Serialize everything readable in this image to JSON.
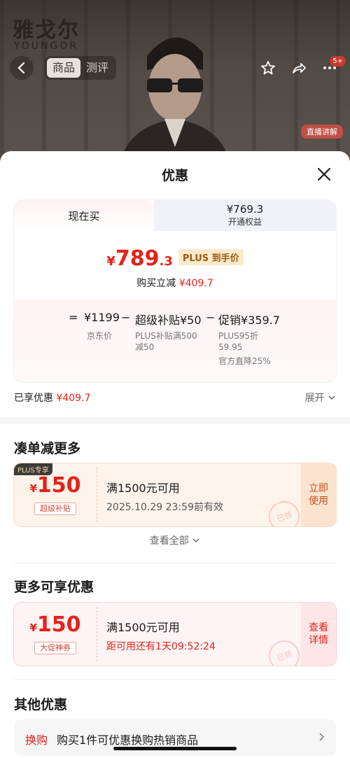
{
  "background": {
    "brand_logo": "雅戈尔",
    "brand_sub": "YOUNGOR",
    "nav_tabs": [
      "商品",
      "测评"
    ],
    "active_tab": 0,
    "more_badge": "5+",
    "live_tag": "直播讲解"
  },
  "sheet": {
    "title": "优惠",
    "price_card": {
      "tab_now": "现在买",
      "tab_plus_price": "¥769.3",
      "tab_plus_label": "开通权益",
      "yen": "¥",
      "price_int": "789",
      "price_dec": ".3",
      "plus_tag": "PLUS 到手价",
      "reduce_label": "购买立减",
      "reduce_value": "¥409.7",
      "formula": {
        "eq": "=",
        "jd_price": "¥1199",
        "minus1": "−",
        "subsidy": "超级补贴¥50",
        "minus2": "−",
        "promo": "促销¥359.7",
        "jd_price_label": "京东价",
        "subsidy_desc": "PLUS补贴满500减50",
        "promo_desc1": "PLUS95折59.95",
        "promo_desc2": "官方直降25%"
      }
    },
    "enjoyed_label": "已享优惠",
    "enjoyed_value": "¥409.7",
    "expand_label": "展开",
    "section1_title": "凑单减更多",
    "coupon1": {
      "badge": "PLUS专享",
      "yen": "¥",
      "amount": "150",
      "label": "超级补贴",
      "condition": "满1500元可用",
      "validity": "2025.10.29 23:59前有效",
      "action": "立即使用",
      "stamp": "已领"
    },
    "view_all": "查看全部",
    "section2_title": "更多可享优惠",
    "coupon2": {
      "yen": "¥",
      "amount": "150",
      "label": "大促神券",
      "condition": "满1500元可用",
      "countdown": "距可用还有1天09:52:24",
      "action": "查看详情",
      "stamp": "已领"
    },
    "section3_title": "其他优惠",
    "other": {
      "tag": "换购",
      "text": "购买1件可优惠换购热销商品"
    }
  },
  "colors": {
    "accent_red": "#e2231a",
    "plus_gold": "#9a5b16"
  }
}
